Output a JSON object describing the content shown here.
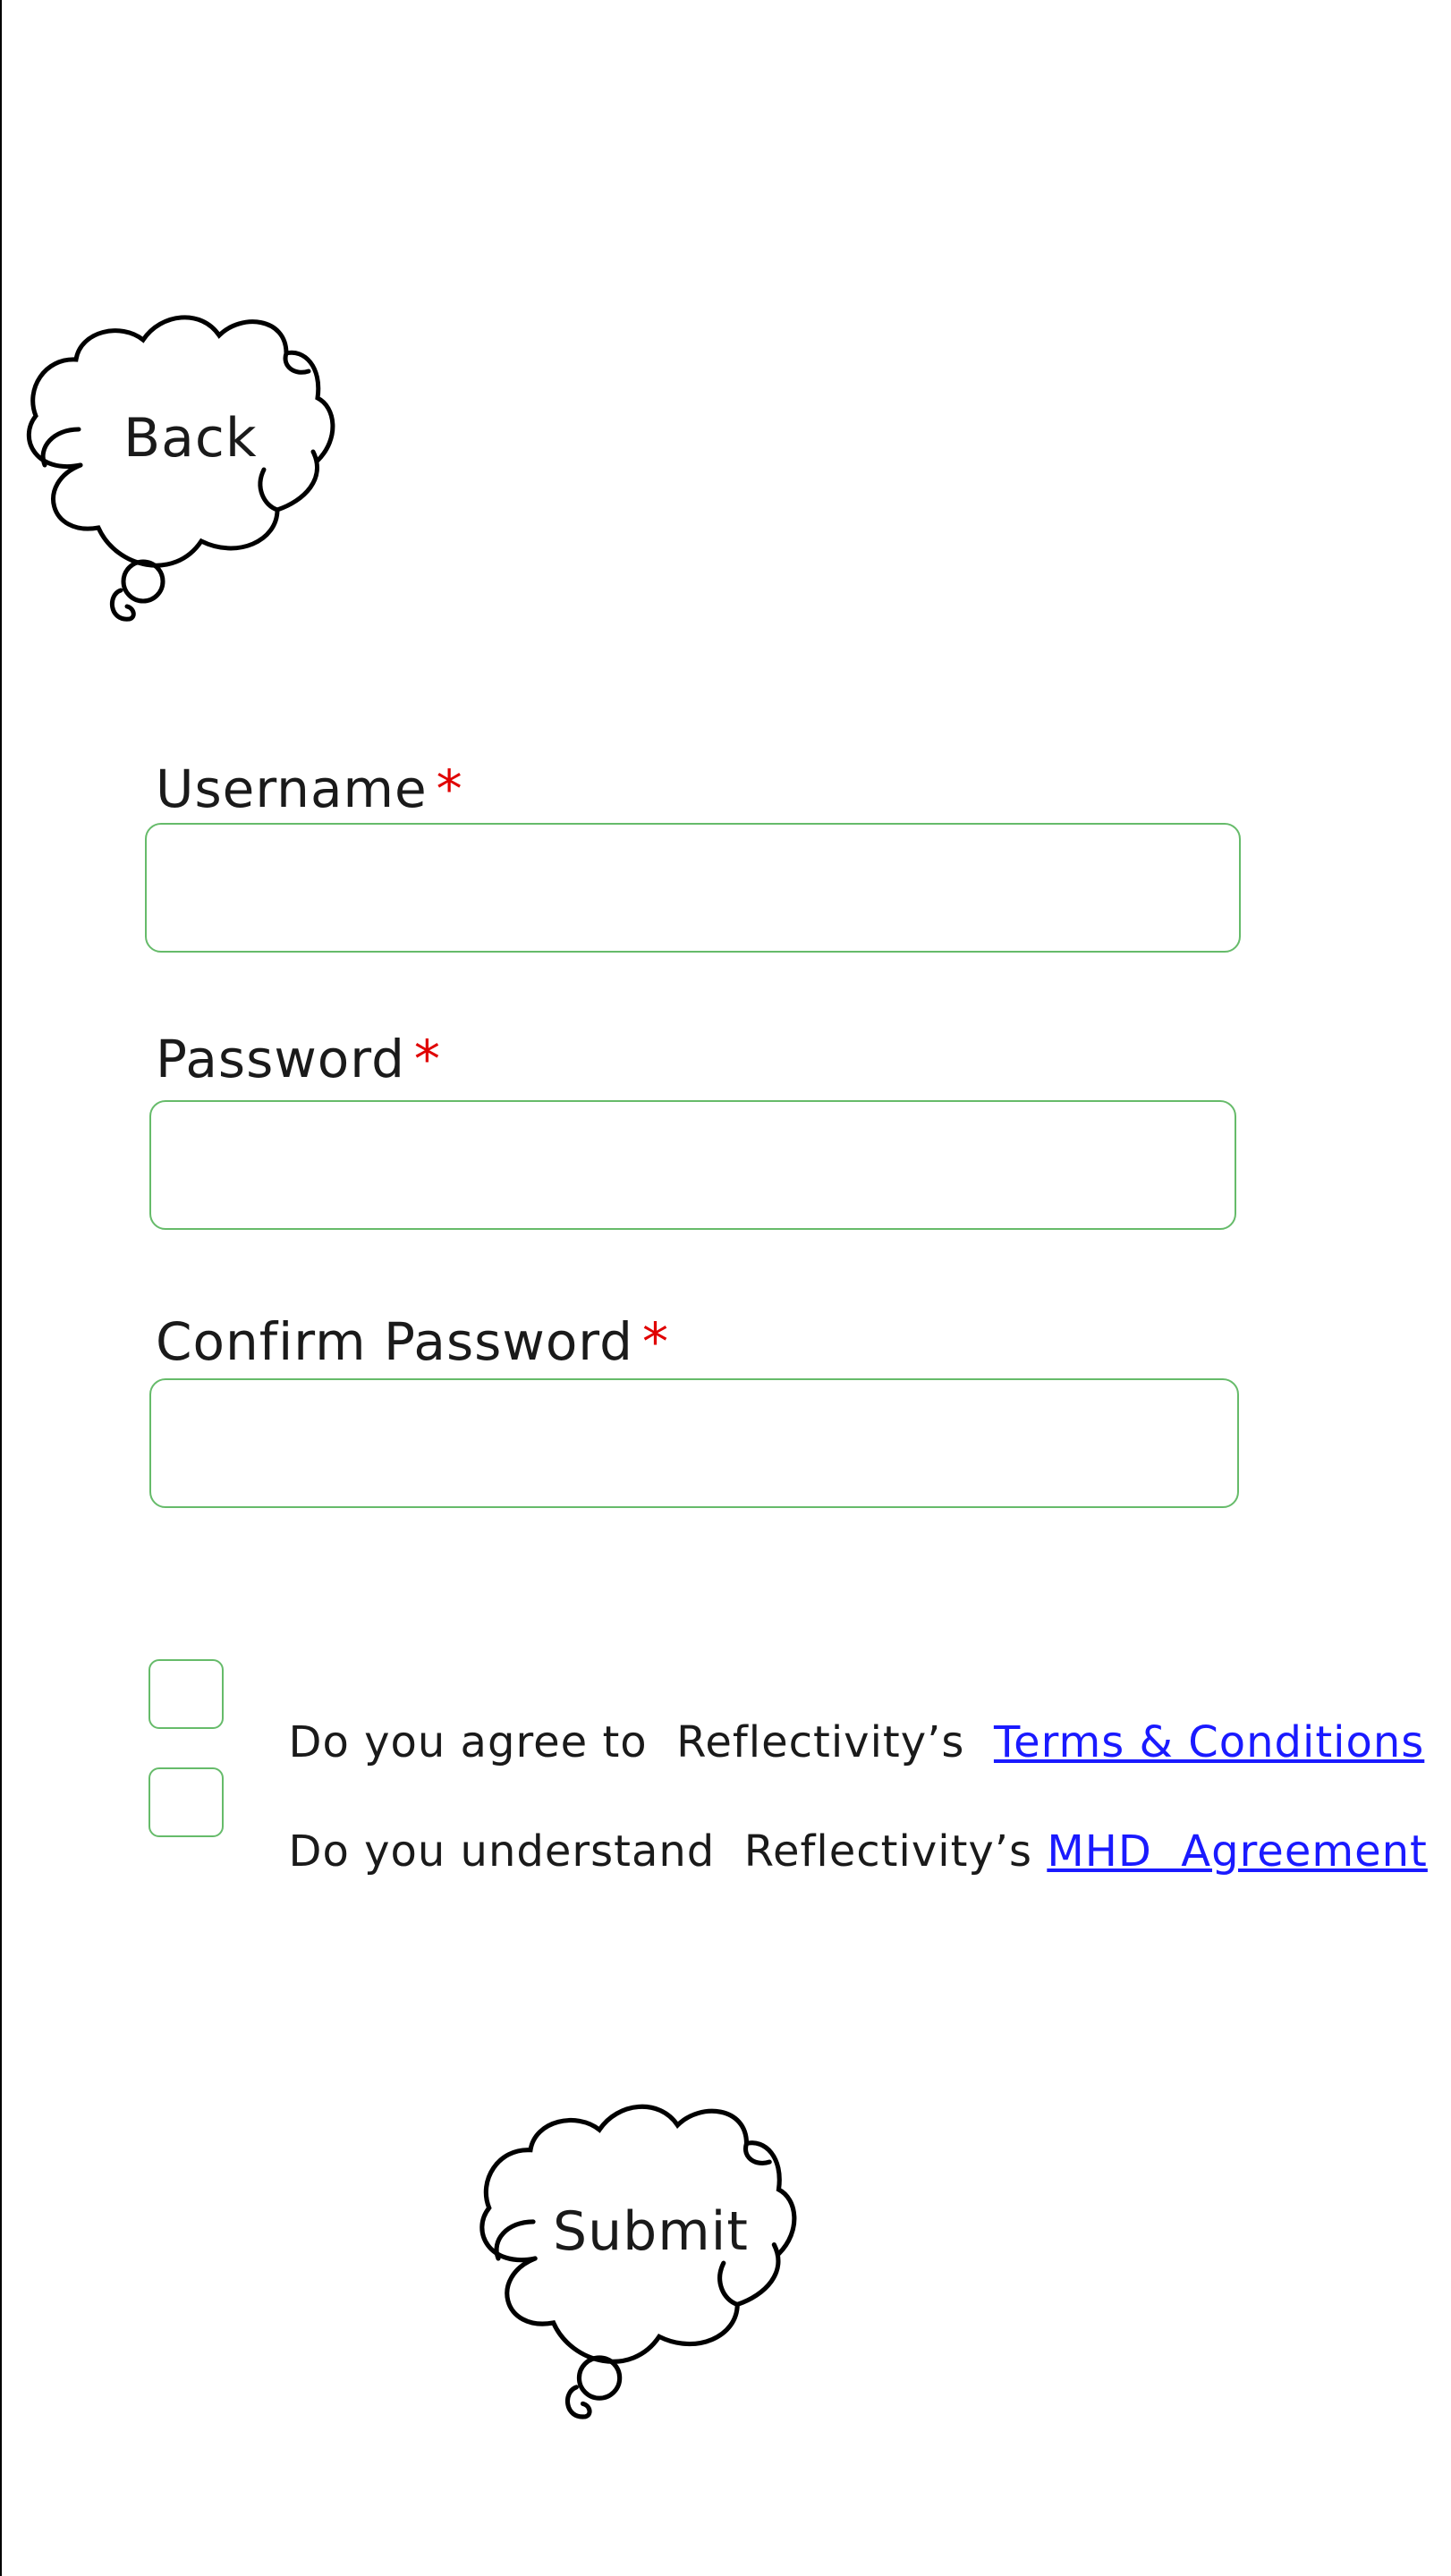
{
  "back_button": {
    "label": "Back"
  },
  "form": {
    "username": {
      "label": "Username",
      "required_mark": "*",
      "value": ""
    },
    "password": {
      "label": "Password",
      "required_mark": "*",
      "value": ""
    },
    "confirm_password": {
      "label": "Confirm Password",
      "required_mark": "*",
      "value": ""
    }
  },
  "agreements": [
    {
      "text": "Do you agree to  Reflectivity’s  ",
      "link": "Terms & Conditions",
      "checked": false
    },
    {
      "text": "Do you understand  Reflectivity’s ",
      "link": "MHD  Agreement",
      "checked": false
    }
  ],
  "submit_button": {
    "label": "Submit"
  },
  "colors": {
    "input_border": "#66bb6a",
    "required": "#e00000",
    "link": "#1a1aff"
  }
}
